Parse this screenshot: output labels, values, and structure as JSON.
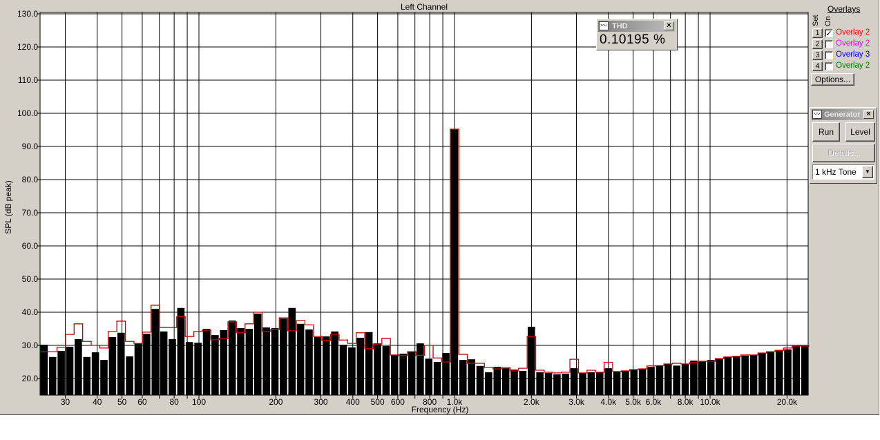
{
  "chart_data": {
    "type": "bar",
    "title": "Left Channel",
    "xlabel": "Frequency (Hz)",
    "ylabel": "SPL (dB peak)",
    "x_scale": "log",
    "xlim_hz": [
      23.9,
      24200
    ],
    "ylim": [
      15,
      130
    ],
    "grid": true,
    "bands_per_octave": 9,
    "ref_band_hz": 1000,
    "ref_band_index": 48,
    "y_ticks": [
      "130.0",
      "120.0",
      "110.0",
      "100.0",
      "90.0",
      "80.0",
      "70.0",
      "60.0",
      "50.0",
      "40.0",
      "30.0",
      "20.0"
    ],
    "x_tick_labels": [
      {
        "hz": 30,
        "label": "30"
      },
      {
        "hz": 40,
        "label": "40"
      },
      {
        "hz": 50,
        "label": "50"
      },
      {
        "hz": 60,
        "label": "60"
      },
      {
        "hz": 80,
        "label": "80"
      },
      {
        "hz": 100,
        "label": "100"
      },
      {
        "hz": 200,
        "label": "200"
      },
      {
        "hz": 300,
        "label": "300"
      },
      {
        "hz": 400,
        "label": "400"
      },
      {
        "hz": 500,
        "label": "500"
      },
      {
        "hz": 600,
        "label": "600"
      },
      {
        "hz": 800,
        "label": "800"
      },
      {
        "hz": 1000,
        "label": "1.0k"
      },
      {
        "hz": 2000,
        "label": "2.0k"
      },
      {
        "hz": 3000,
        "label": "3.0k"
      },
      {
        "hz": 4000,
        "label": "4.0k"
      },
      {
        "hz": 5000,
        "label": "5.0k"
      },
      {
        "hz": 6000,
        "label": "6.0k"
      },
      {
        "hz": 8000,
        "label": "8.0k"
      },
      {
        "hz": 10000,
        "label": "10.0k"
      },
      {
        "hz": 20000,
        "label": "20.0k"
      }
    ],
    "x_gridlines_hz": [
      30,
      40,
      50,
      60,
      70,
      80,
      90,
      100,
      200,
      300,
      400,
      500,
      600,
      700,
      800,
      900,
      1000,
      2000,
      3000,
      4000,
      5000,
      6000,
      7000,
      8000,
      9000,
      10000,
      20000
    ],
    "series": [
      {
        "name": "Left Channel",
        "color": "#000000",
        "values": [
          30.2,
          26.5,
          28.3,
          29.6,
          31.9,
          26.5,
          27.9,
          25.6,
          32.5,
          33.8,
          26.7,
          30.6,
          33.5,
          41.0,
          34.2,
          31.9,
          41.3,
          31.0,
          30.8,
          35.0,
          33.1,
          34.6,
          37.5,
          35.2,
          35.0,
          39.6,
          35.4,
          35.2,
          38.1,
          41.3,
          36.5,
          34.8,
          32.5,
          32.7,
          34.2,
          30.2,
          29.4,
          32.3,
          34.0,
          30.6,
          29.8,
          27.1,
          27.5,
          28.1,
          30.6,
          26.0,
          25.0,
          27.7,
          95.2,
          25.6,
          25.8,
          23.8,
          21.9,
          23.5,
          23.1,
          22.7,
          22.3,
          35.6,
          21.9,
          21.7,
          21.3,
          21.5,
          23.1,
          21.7,
          21.9,
          21.9,
          23.1,
          22.1,
          22.3,
          22.7,
          22.9,
          23.5,
          23.9,
          24.4,
          23.9,
          24.4,
          25.4,
          25.2,
          25.6,
          26.0,
          26.5,
          26.7,
          26.9,
          27.1,
          27.7,
          28.1,
          28.5,
          28.8,
          29.8,
          29.8
        ]
      },
      {
        "name": "Overlay 2",
        "color": "#cc0000",
        "values": [
          28.1,
          28.1,
          29.4,
          33.3,
          36.5,
          31.2,
          30.0,
          29.2,
          34.2,
          37.3,
          31.2,
          30.6,
          34.0,
          42.1,
          35.4,
          35.4,
          38.7,
          32.7,
          34.2,
          34.6,
          31.7,
          32.1,
          37.1,
          33.8,
          36.5,
          40.0,
          34.2,
          34.8,
          38.3,
          34.4,
          37.5,
          36.2,
          32.7,
          31.5,
          33.3,
          31.6,
          30.6,
          33.8,
          29.0,
          30.4,
          32.1,
          27.1,
          26.9,
          28.1,
          27.0,
          30.0,
          26.2,
          25.0,
          95.2,
          27.3,
          24.6,
          24.6,
          23.3,
          22.9,
          23.3,
          22.3,
          23.1,
          32.7,
          22.5,
          21.9,
          21.7,
          21.9,
          25.8,
          21.7,
          22.5,
          21.9,
          24.9,
          22.1,
          22.3,
          22.7,
          22.9,
          23.8,
          23.9,
          24.4,
          24.6,
          24.4,
          24.8,
          25.2,
          25.2,
          26.0,
          26.5,
          26.7,
          27.1,
          27.1,
          27.7,
          28.1,
          28.5,
          29.2,
          29.8,
          29.8
        ]
      }
    ]
  },
  "thd": {
    "title": "THD",
    "value": "0.10195 %"
  },
  "overlays": {
    "heading": "Overlays",
    "set_label": "Set",
    "on_label": "On",
    "rows": [
      {
        "set": "1",
        "checked": true,
        "check_mark": "✓",
        "label": "Overlay 2",
        "color": "#ff0000"
      },
      {
        "set": "2",
        "checked": false,
        "check_mark": "",
        "label": "Overlay 2",
        "color": "#ff00ff"
      },
      {
        "set": "3",
        "checked": false,
        "check_mark": "",
        "label": "Overlay 3",
        "color": "#0000ff"
      },
      {
        "set": "4",
        "checked": false,
        "check_mark": "",
        "label": "Overlay 2",
        "color": "#008000"
      }
    ],
    "options_label": "Options..."
  },
  "generator": {
    "title": "Generator",
    "run_label": "Run",
    "level_label": "Level",
    "details_label": "Details...",
    "signal_selected": "1 kHz Tone"
  },
  "icons": {
    "window_icon": "waveform-icon",
    "close": "×"
  }
}
